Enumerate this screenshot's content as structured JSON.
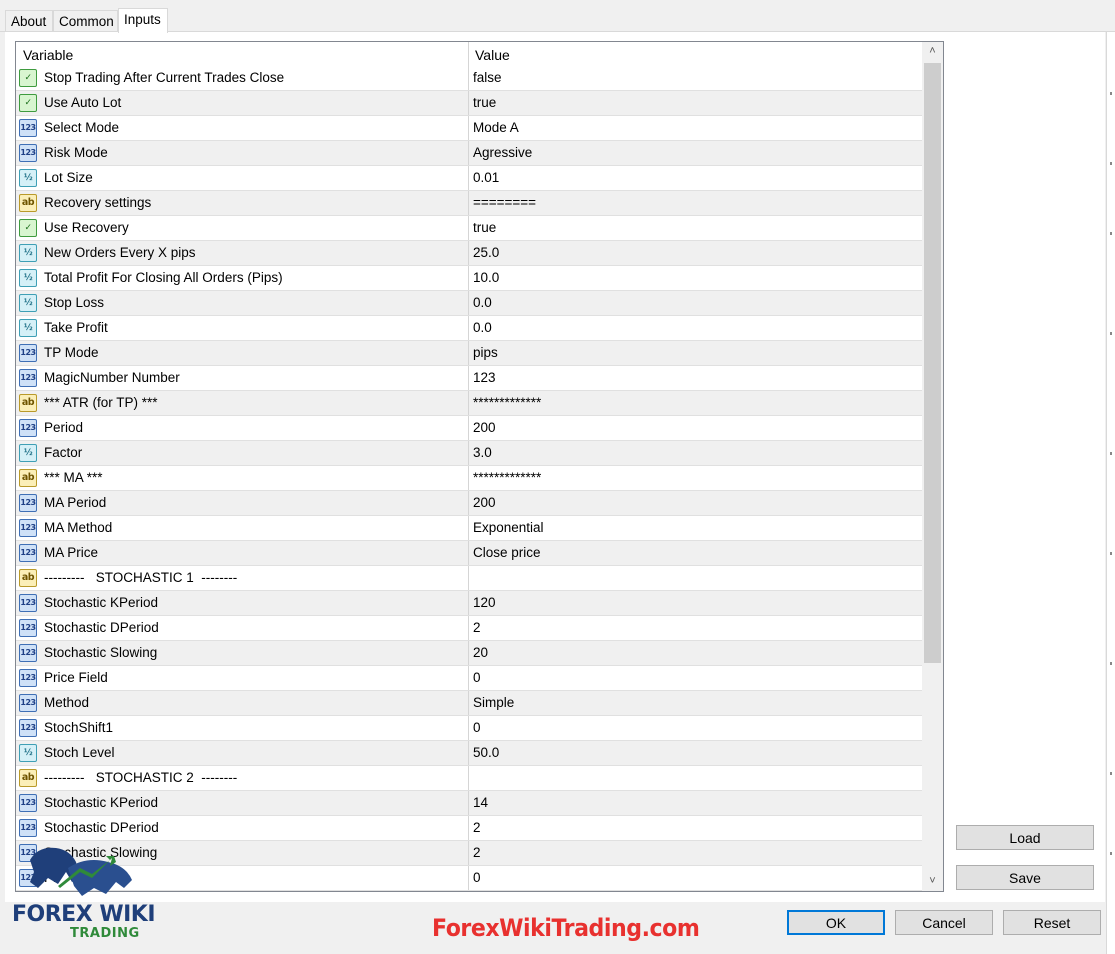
{
  "tabs": [
    {
      "label": "About"
    },
    {
      "label": "Common"
    },
    {
      "label": "Inputs",
      "active": true
    }
  ],
  "grid": {
    "columns": [
      "Variable",
      "Value"
    ],
    "rows": [
      {
        "type": "bool",
        "icon": "bool-type-icon",
        "variable": "Stop Trading After Current Trades Close",
        "value": "false"
      },
      {
        "type": "bool",
        "icon": "bool-type-icon",
        "variable": "Use Auto Lot",
        "value": "true"
      },
      {
        "type": "int",
        "icon": "int-type-icon",
        "variable": "Select Mode",
        "value": "Mode A"
      },
      {
        "type": "int",
        "icon": "int-type-icon",
        "variable": "Risk Mode",
        "value": "Agressive"
      },
      {
        "type": "dbl",
        "icon": "double-type-icon",
        "variable": "Lot Size",
        "value": "0.01"
      },
      {
        "type": "str",
        "icon": "string-type-icon",
        "variable": "Recovery settings",
        "value": "========"
      },
      {
        "type": "bool",
        "icon": "bool-type-icon",
        "variable": "Use Recovery",
        "value": "true"
      },
      {
        "type": "dbl",
        "icon": "double-type-icon",
        "variable": "New Orders Every X pips",
        "value": "25.0"
      },
      {
        "type": "dbl",
        "icon": "double-type-icon",
        "variable": "Total Profit For Closing All Orders (Pips)",
        "value": "10.0"
      },
      {
        "type": "dbl",
        "icon": "double-type-icon",
        "variable": "Stop Loss",
        "value": "0.0"
      },
      {
        "type": "dbl",
        "icon": "double-type-icon",
        "variable": "Take Profit",
        "value": "0.0"
      },
      {
        "type": "int",
        "icon": "int-type-icon",
        "variable": "TP Mode",
        "value": "pips"
      },
      {
        "type": "int",
        "icon": "int-type-icon",
        "variable": "MagicNumber Number",
        "value": "123"
      },
      {
        "type": "str",
        "icon": "string-type-icon",
        "variable": "*** ATR (for TP) ***",
        "value": "*************"
      },
      {
        "type": "int",
        "icon": "int-type-icon",
        "variable": "Period",
        "value": "200"
      },
      {
        "type": "dbl",
        "icon": "double-type-icon",
        "variable": "Factor",
        "value": "3.0"
      },
      {
        "type": "str",
        "icon": "string-type-icon",
        "variable": "*** MA ***",
        "value": "*************"
      },
      {
        "type": "int",
        "icon": "int-type-icon",
        "variable": "MA Period",
        "value": "200"
      },
      {
        "type": "int",
        "icon": "int-type-icon",
        "variable": "MA Method",
        "value": "Exponential"
      },
      {
        "type": "int",
        "icon": "int-type-icon",
        "variable": "MA Price",
        "value": "Close price"
      },
      {
        "type": "str",
        "icon": "string-type-icon",
        "variable": "---------   STOCHASTIC 1  --------",
        "value": ""
      },
      {
        "type": "int",
        "icon": "int-type-icon",
        "variable": "Stochastic KPeriod",
        "value": "120"
      },
      {
        "type": "int",
        "icon": "int-type-icon",
        "variable": "Stochastic DPeriod",
        "value": "2"
      },
      {
        "type": "int",
        "icon": "int-type-icon",
        "variable": "Stochastic Slowing",
        "value": "20"
      },
      {
        "type": "int",
        "icon": "int-type-icon",
        "variable": "Price Field",
        "value": "0"
      },
      {
        "type": "int",
        "icon": "int-type-icon",
        "variable": "Method",
        "value": "Simple"
      },
      {
        "type": "int",
        "icon": "int-type-icon",
        "variable": "StochShift1",
        "value": "0"
      },
      {
        "type": "dbl",
        "icon": "double-type-icon",
        "variable": "Stoch Level",
        "value": "50.0"
      },
      {
        "type": "str",
        "icon": "string-type-icon",
        "variable": "---------   STOCHASTIC 2  --------",
        "value": ""
      },
      {
        "type": "int",
        "icon": "int-type-icon",
        "variable": "Stochastic KPeriod",
        "value": "14"
      },
      {
        "type": "int",
        "icon": "int-type-icon",
        "variable": "Stochastic DPeriod",
        "value": "2"
      },
      {
        "type": "int",
        "icon": "int-type-icon",
        "variable": "Stochastic Slowing",
        "value": "2"
      },
      {
        "type": "int",
        "icon": "int-type-icon",
        "variable": "Pr",
        "value": "0"
      }
    ]
  },
  "icon_glyphs": {
    "bool": "✓",
    "int": "123",
    "dbl": "½",
    "str": "ab"
  },
  "buttons": {
    "load": "Load",
    "save": "Save",
    "ok": "OK",
    "cancel": "Cancel",
    "reset": "Reset"
  },
  "watermark": {
    "logo_forex": "FOREX WIKI",
    "logo_trading": "TRADING",
    "url": "ForexWikiTrading.com"
  },
  "colors": {
    "accent": "#0078d7",
    "watermark_red": "#e8312f",
    "logo_blue": "#1f3f7a",
    "logo_green": "#2f8a3a"
  }
}
